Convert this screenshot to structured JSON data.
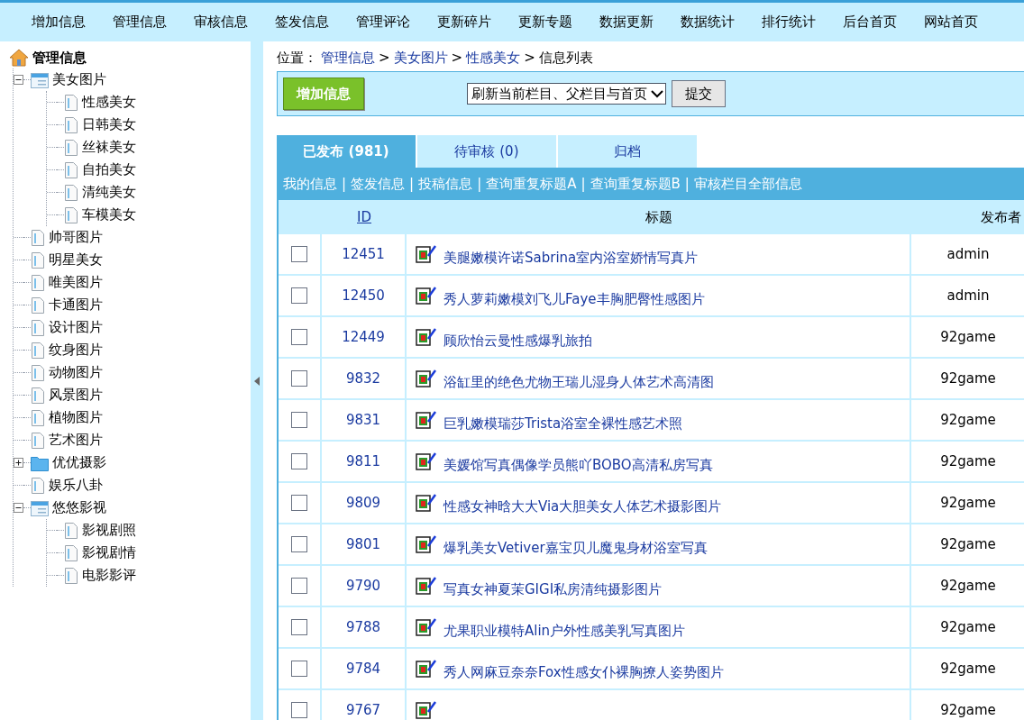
{
  "top_nav": [
    "增加信息",
    "管理信息",
    "审核信息",
    "签发信息",
    "管理评论",
    "更新碎片",
    "更新专题",
    "数据更新",
    "数据统计",
    "排行统计",
    "后台首页",
    "网站首页"
  ],
  "sidebar": {
    "title": "管理信息",
    "tree": [
      {
        "label": "美女图片",
        "kind": "folder",
        "expanded": true,
        "children": [
          {
            "label": "性感美女",
            "kind": "page"
          },
          {
            "label": "日韩美女",
            "kind": "page"
          },
          {
            "label": "丝袜美女",
            "kind": "page"
          },
          {
            "label": "自拍美女",
            "kind": "page"
          },
          {
            "label": "清纯美女",
            "kind": "page"
          },
          {
            "label": "车模美女",
            "kind": "page"
          }
        ]
      },
      {
        "label": "帅哥图片",
        "kind": "page"
      },
      {
        "label": "明星美女",
        "kind": "page"
      },
      {
        "label": "唯美图片",
        "kind": "page"
      },
      {
        "label": "卡通图片",
        "kind": "page"
      },
      {
        "label": "设计图片",
        "kind": "page"
      },
      {
        "label": "纹身图片",
        "kind": "page"
      },
      {
        "label": "动物图片",
        "kind": "page"
      },
      {
        "label": "风景图片",
        "kind": "page"
      },
      {
        "label": "植物图片",
        "kind": "page"
      },
      {
        "label": "艺术图片",
        "kind": "page"
      },
      {
        "label": "优优摄影",
        "kind": "folder",
        "expanded": false
      },
      {
        "label": "娱乐八卦",
        "kind": "page"
      },
      {
        "label": "悠悠影视",
        "kind": "folder",
        "expanded": true,
        "children": [
          {
            "label": "影视剧照",
            "kind": "page"
          },
          {
            "label": "影视剧情",
            "kind": "page"
          },
          {
            "label": "电影影评",
            "kind": "page"
          }
        ]
      }
    ]
  },
  "breadcrumb": {
    "prefix": "位置：",
    "links": [
      "管理信息",
      "美女图片",
      "性感美女"
    ],
    "current": "信息列表",
    "separator": ">"
  },
  "toolbar": {
    "add_button": "增加信息",
    "refresh_select": "刷新当前栏目、父栏目与首页",
    "submit_button": "提交"
  },
  "tabs": [
    {
      "label": "已发布 (981)",
      "selected": true
    },
    {
      "label": "待审核 (0)",
      "selected": false
    },
    {
      "label": "归档",
      "selected": false
    }
  ],
  "filter_separator": "|",
  "filter_links": [
    "我的信息",
    "签发信息",
    "投稿信息",
    "查询重复标题A",
    "查询重复标题B",
    "审核栏目全部信息"
  ],
  "table": {
    "columns": [
      "ID",
      "标题",
      "发布者"
    ],
    "rows": [
      {
        "checked": false,
        "id": "12451",
        "title": "美腿嫩模许诺Sabrina室内浴室娇情写真片",
        "publisher": "admin"
      },
      {
        "checked": false,
        "id": "12450",
        "title": "秀人萝莉嫩模刘飞儿Faye丰胸肥臀性感图片",
        "publisher": "admin"
      },
      {
        "checked": false,
        "id": "12449",
        "title": "顾欣怡云曼性感爆乳旅拍",
        "publisher": "92game"
      },
      {
        "checked": false,
        "id": "9832",
        "title": "浴缸里的绝色尤物王瑞儿湿身人体艺术高清图",
        "publisher": "92game"
      },
      {
        "checked": false,
        "id": "9831",
        "title": "巨乳嫩模瑞莎Trista浴室全裸性感艺术照",
        "publisher": "92game"
      },
      {
        "checked": false,
        "id": "9811",
        "title": "美媛馆写真偶像学员熊吖BOBO高清私房写真",
        "publisher": "92game"
      },
      {
        "checked": false,
        "id": "9809",
        "title": "性感女神晗大大Via大胆美女人体艺术摄影图片",
        "publisher": "92game"
      },
      {
        "checked": false,
        "id": "9801",
        "title": "爆乳美女Vetiver嘉宝贝儿魔鬼身材浴室写真",
        "publisher": "92game"
      },
      {
        "checked": false,
        "id": "9790",
        "title": "写真女神夏茉GIGI私房清纯摄影图片",
        "publisher": "92game"
      },
      {
        "checked": false,
        "id": "9788",
        "title": "尤果职业模特Alin户外性感美乳写真图片",
        "publisher": "92game"
      },
      {
        "checked": false,
        "id": "9784",
        "title": "秀人网麻豆奈奈Fox性感女仆裸胸撩人姿势图片",
        "publisher": "92game"
      },
      {
        "checked": false,
        "id": "9767",
        "publisher": "92game"
      }
    ]
  }
}
